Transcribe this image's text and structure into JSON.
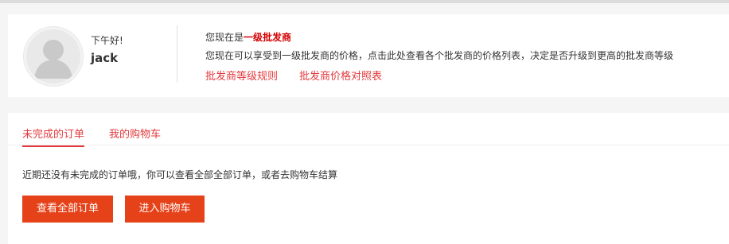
{
  "profile": {
    "greeting": "下午好!",
    "username": "jack",
    "level_prefix": "您现在是",
    "level_name": "一级批发商",
    "description": "您现在可以享受到一级批发商的价格，点击此处查看各个批发商的价格列表，决定是否升级到更高的批发商等级",
    "links": {
      "rules": "批发商等级规则",
      "price_table": "批发商价格对照表"
    }
  },
  "orders": {
    "tabs": [
      {
        "label": "未完成的订单",
        "active": true
      },
      {
        "label": "我的购物车",
        "active": false
      }
    ],
    "empty_message": "近期还没有未完成的订单哦，你可以查看全部全部订单，或者去购物车结算",
    "buttons": {
      "view_all": "查看全部订单",
      "go_cart": "进入购物车"
    }
  },
  "colors": {
    "accent": "#e4393c",
    "button": "#e64219",
    "level_highlight": "#d40000"
  }
}
